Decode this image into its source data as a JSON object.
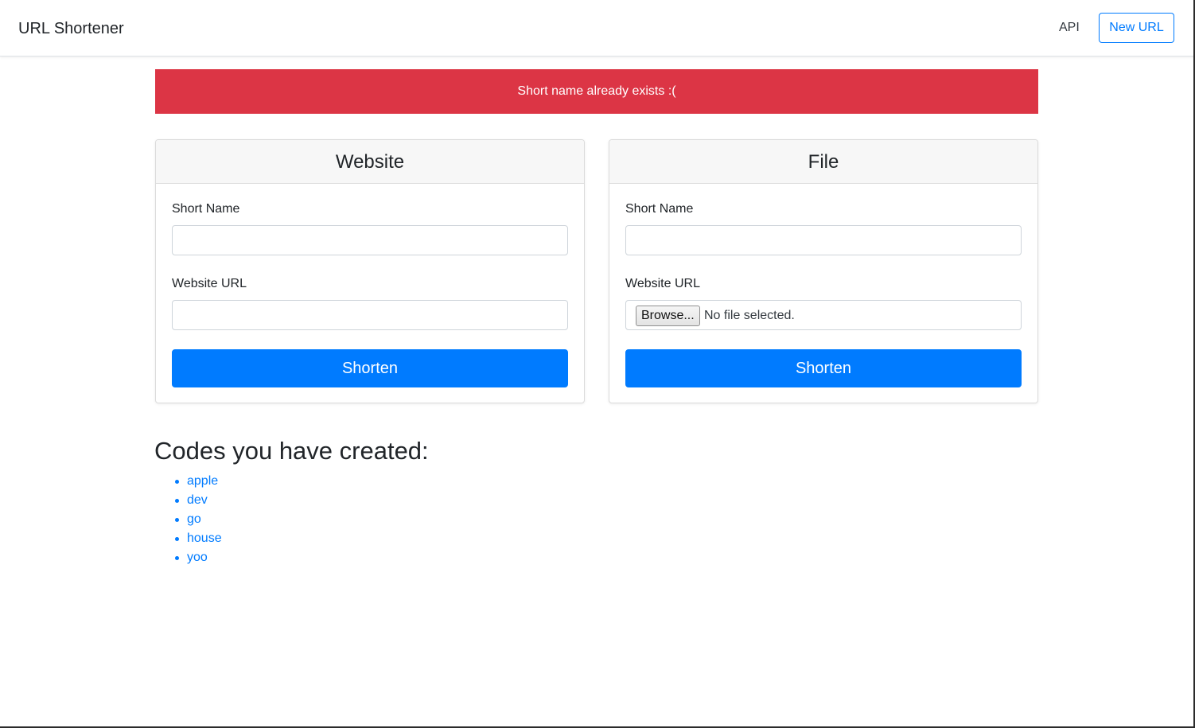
{
  "navbar": {
    "brand": "URL Shortener",
    "api_link": "API",
    "new_url_button": "New URL"
  },
  "alert": {
    "message": "Short name already exists :("
  },
  "website_card": {
    "title": "Website",
    "short_name_label": "Short Name",
    "short_name_value": "",
    "url_label": "Website URL",
    "url_value": "",
    "submit_label": "Shorten"
  },
  "file_card": {
    "title": "File",
    "short_name_label": "Short Name",
    "short_name_value": "",
    "file_label": "Website URL",
    "browse_label": "Browse...",
    "file_status": "No file selected.",
    "submit_label": "Shorten"
  },
  "codes": {
    "heading": "Codes you have created:",
    "items": [
      "apple",
      "dev",
      "go",
      "house",
      "yoo"
    ]
  },
  "colors": {
    "primary": "#007bff",
    "danger": "#dc3545",
    "text": "#212529"
  }
}
